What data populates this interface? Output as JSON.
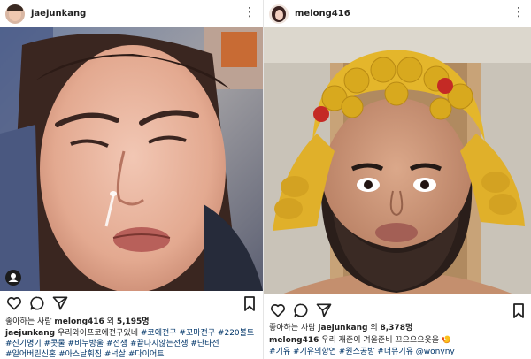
{
  "left_post": {
    "username": "jaejunkang",
    "more_icon": "⋮",
    "likes_prefix": "좋아하는 사람 ",
    "likes_user": "melong416",
    "likes_mid": " 외 ",
    "likes_count": "5,195명",
    "caption_user": "jaejunkang",
    "caption_text": " 우리와이프코에전구있네 ",
    "line1_tags": "#코에전구 #꼬마전구 #220볼트",
    "line2_tags": "#진기명기 #콧물 #비누방울 #전쟁 #끝나지않는전쟁 #난타전",
    "line3_tags": "#일어버린신혼 #아스날휘짐 #넉살 #다이어트",
    "icons": [
      "heart-outline-icon",
      "comment-icon",
      "share-icon",
      "bookmark-icon",
      "person-tag-icon"
    ]
  },
  "right_post": {
    "username": "melong416",
    "more_icon": "⋮",
    "likes_prefix": "좋아하는 사람 ",
    "likes_user": "jaejunkang",
    "likes_mid": " 외 ",
    "likes_count": "8,378명",
    "caption_user": "melong416",
    "caption_text": " 우리 재준이 겨울준비 끄으으으읏을 ",
    "caption_emoji": "🍤",
    "line2_tags": "#기유 #기유의향연 #원스공방 #너뮤기유 @wonyny",
    "icons": [
      "heart-outline-icon",
      "comment-icon",
      "share-icon",
      "bookmark-icon"
    ]
  }
}
